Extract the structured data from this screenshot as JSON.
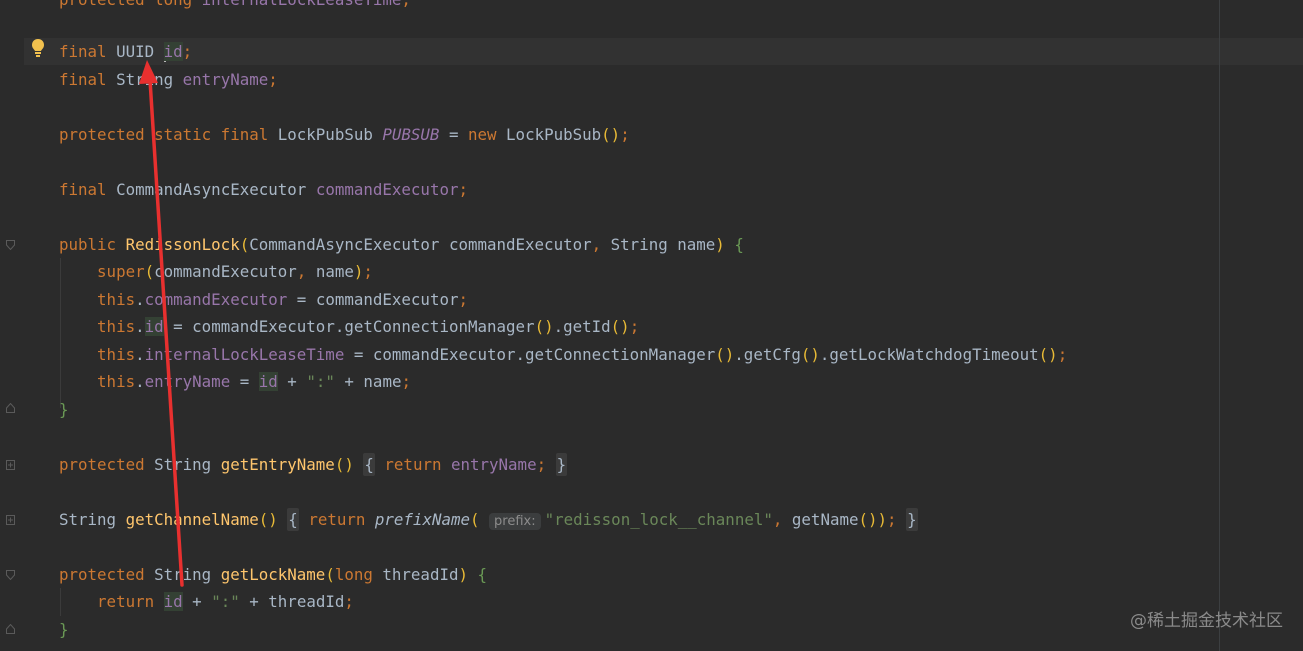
{
  "editor": {
    "language": "Java",
    "lines": [
      "protected long internalLockLeaseTime;",
      "final UUID id;",
      "final String entryName;",
      "protected static final LockPubSub PUBSUB = new LockPubSub();",
      "final CommandAsyncExecutor commandExecutor;",
      "public RedissonLock(CommandAsyncExecutor commandExecutor, String name) {",
      "super(commandExecutor, name);",
      "this.commandExecutor = commandExecutor;",
      "this.id = commandExecutor.getConnectionManager().getId();",
      "this.internalLockLeaseTime = commandExecutor.getConnectionManager().getCfg().getLockWatchdogTimeout();",
      "this.entryName = id + \":\" + name;",
      "}",
      "protected String getEntryName() { return entryName; }",
      "String getChannelName() { return prefixName( prefix: \"redisson_lock__channel\", getName()); }",
      "protected String getLockName(long threadId) {",
      "return id + \":\" + threadId;",
      "}"
    ],
    "inlay_hint": "prefix:",
    "icons": [
      "lightbulb-icon",
      "fold-icon",
      "arrow-annotation"
    ]
  },
  "colors": {
    "background": "#2b2b2b",
    "keyword": "#cc7832",
    "field": "#9876aa",
    "method": "#ffc66d",
    "string": "#6a8759",
    "arrow": "#e8302f"
  },
  "watermark": "@稀土掘金技术社区"
}
